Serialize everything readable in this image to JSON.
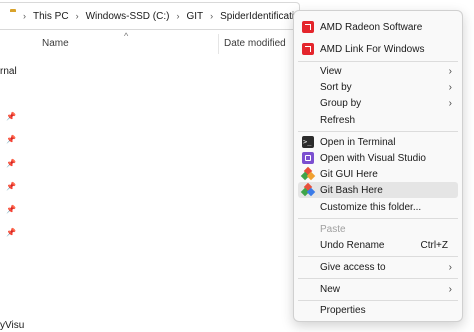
{
  "address_bar": {
    "crumbs": [
      "This PC",
      "Windows-SSD (C:)",
      "GIT",
      "SpiderIdentificationKey"
    ]
  },
  "columns": {
    "name": "Name",
    "date_modified": "Date modified"
  },
  "nav_pane": {
    "terminal_fragment": "rnal",
    "bottom_fragment": "yVisu"
  },
  "context_menu": {
    "items": [
      {
        "label": "AMD Radeon Software",
        "icon": "amd-icon"
      },
      {
        "label": "AMD Link For Windows",
        "icon": "amd-icon"
      },
      {
        "label": "View",
        "submenu": true
      },
      {
        "label": "Sort by",
        "submenu": true
      },
      {
        "label": "Group by",
        "submenu": true
      },
      {
        "label": "Refresh"
      },
      {
        "label": "Open in Terminal",
        "icon": "terminal-icon"
      },
      {
        "label": "Open with Visual Studio",
        "icon": "visual-studio-icon"
      },
      {
        "label": "Git GUI Here",
        "icon": "git-gui-icon"
      },
      {
        "label": "Git Bash Here",
        "icon": "git-bash-icon"
      },
      {
        "label": "Customize this folder..."
      },
      {
        "label": "Paste",
        "disabled": true
      },
      {
        "label": "Undo Rename",
        "shortcut": "Ctrl+Z"
      },
      {
        "label": "Give access to",
        "submenu": true
      },
      {
        "label": "New",
        "submenu": true
      },
      {
        "label": "Properties"
      }
    ],
    "submenu_arrow": "›"
  },
  "colors": {
    "amd_red": "#e4252c",
    "vs_purple": "#7b4fd0",
    "git_red": "#e8503a",
    "git_green": "#3fa54a",
    "menu_bg": "#f9f9f9",
    "hover_bg": "#e5e5e5"
  }
}
